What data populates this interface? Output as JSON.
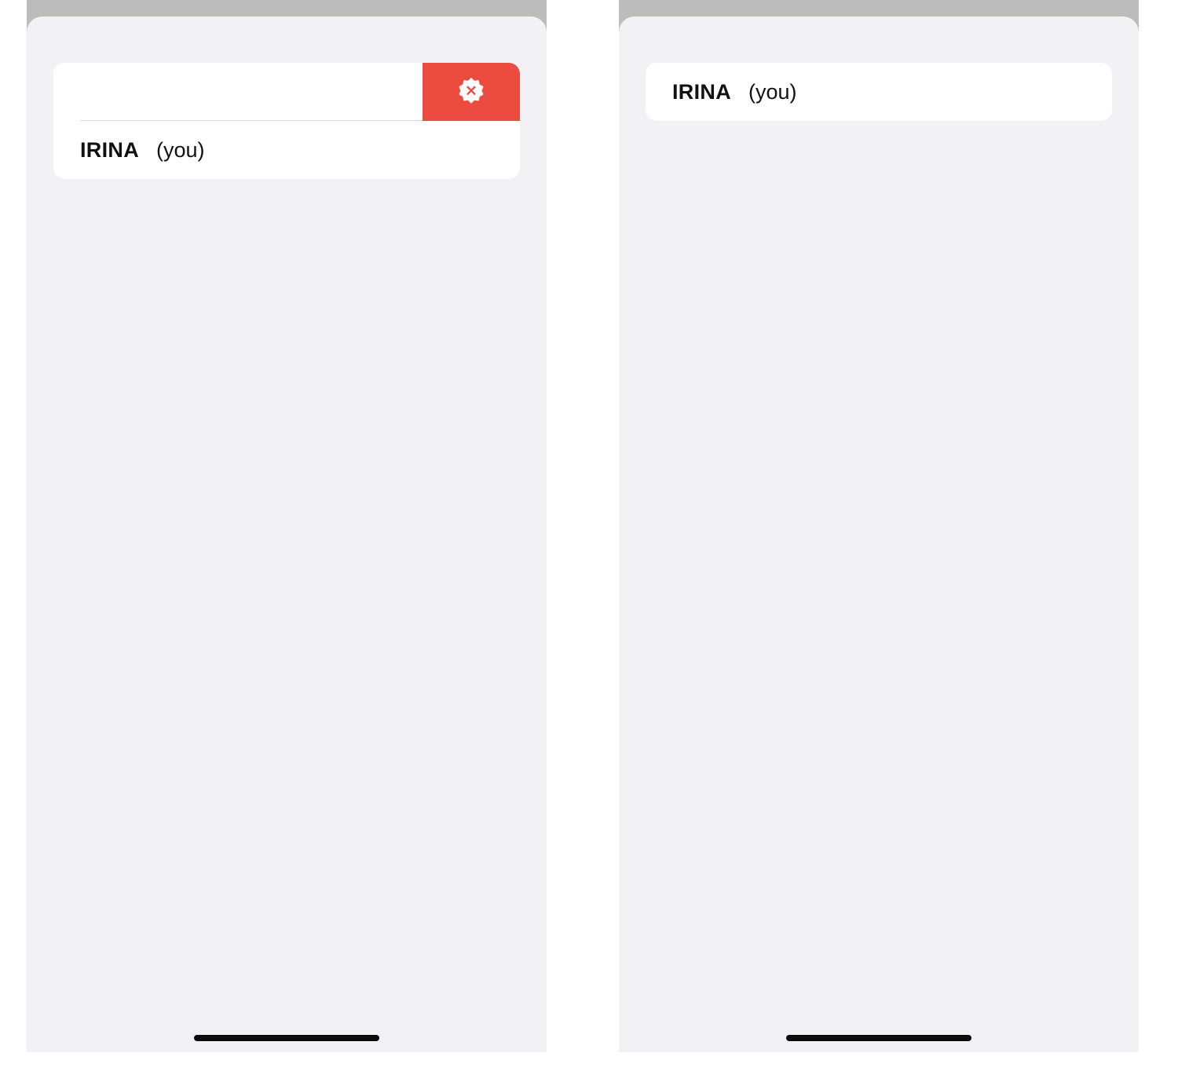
{
  "screens": [
    {
      "state": "swiped",
      "members": [
        {
          "name": "IRINA",
          "tag": "(you)"
        }
      ],
      "swipe_action": {
        "icon": "remove-badge-icon",
        "color": "#eb4c3f"
      }
    },
    {
      "state": "default",
      "members": [
        {
          "name": "IRINA",
          "tag": "(you)"
        }
      ]
    }
  ],
  "colors": {
    "sheet_background": "#f1f1f6",
    "card_background": "#ffffff",
    "backdrop": "#bcbdba",
    "destructive": "#eb4c3f"
  }
}
